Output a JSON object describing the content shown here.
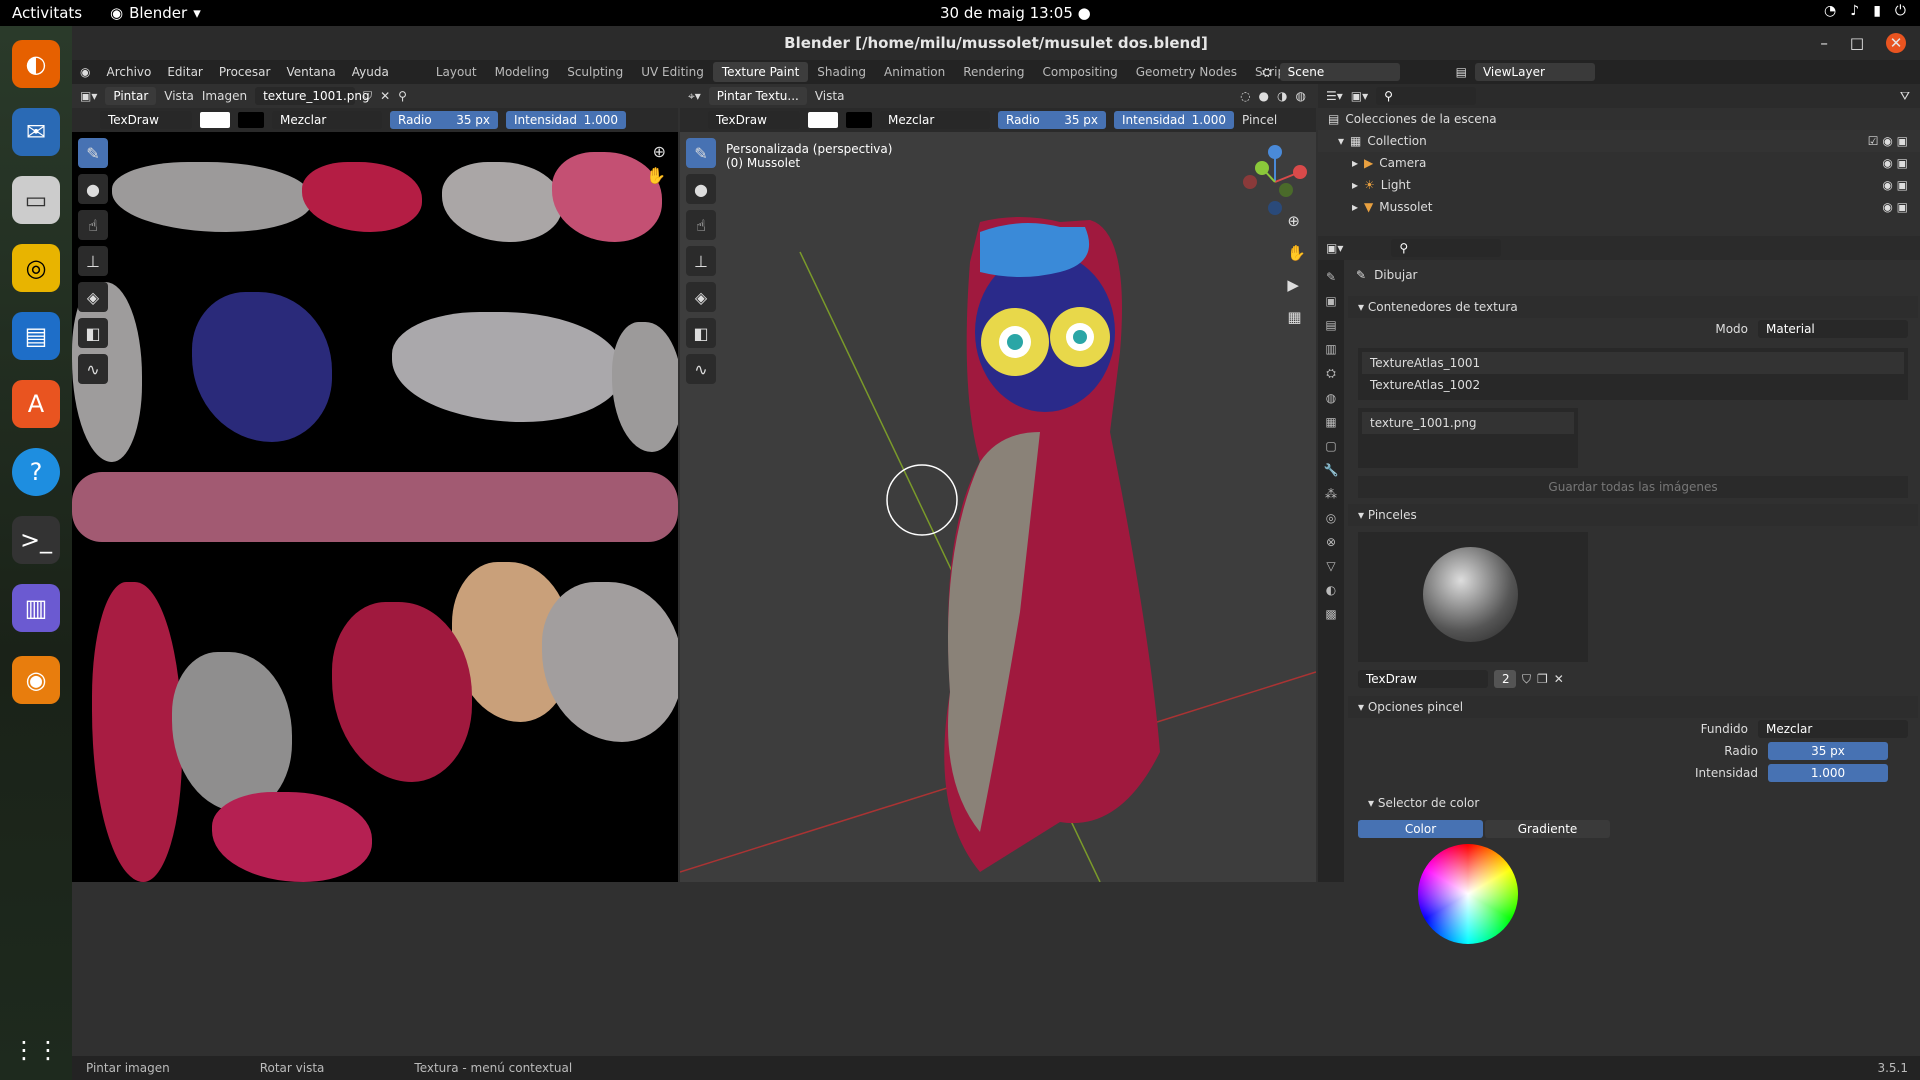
{
  "system": {
    "activities": "Activitats",
    "app_name": "Blender",
    "clock": "30 de maig  13:05"
  },
  "window": {
    "title": "Blender [/home/milu/mussolet/musulet dos.blend]"
  },
  "menu": [
    "Archivo",
    "Editar",
    "Procesar",
    "Ventana",
    "Ayuda"
  ],
  "workspaces": [
    "Layout",
    "Modeling",
    "Sculpting",
    "UV Editing",
    "Texture Paint",
    "Shading",
    "Animation",
    "Rendering",
    "Compositing",
    "Geometry Nodes",
    "Scripting"
  ],
  "active_workspace": "Texture Paint",
  "scene": {
    "scene": "Scene",
    "view_layer": "ViewLayer"
  },
  "image_editor": {
    "mode": "Pintar",
    "menu_vista": "Vista",
    "menu_imagen": "Imagen",
    "image": "texture_1001.png",
    "brush": "TexDraw",
    "blend": "Mezclar",
    "radius_label": "Radio",
    "radius": "35 px",
    "strength_label": "Intensidad",
    "strength": "1.000"
  },
  "viewport": {
    "mode": "Pintar Textu...",
    "menu_vista": "Vista",
    "brush": "TexDraw",
    "blend": "Mezclar",
    "radius_label": "Radio",
    "radius": "35 px",
    "strength_label": "Intensidad",
    "strength": "1.000",
    "brush_tab": "Pincel",
    "info1": "Personalizada (perspectiva)",
    "info2": "(0) Mussolet"
  },
  "outliner": {
    "root": "Colecciones de la escena",
    "collection": "Collection",
    "items": [
      "Camera",
      "Light",
      "Mussolet"
    ]
  },
  "properties": {
    "tool": "Dibujar",
    "section_tex": "Contenedores de textura",
    "mode_label": "Modo",
    "mode": "Material",
    "atlas": [
      "TextureAtlas_1001",
      "TextureAtlas_1002"
    ],
    "texture": "texture_1001.png",
    "save_all": "Guardar todas las imágenes",
    "section_brushes": "Pinceles",
    "brush_name": "TexDraw",
    "brush_users": "2",
    "section_opts": "Opciones pincel",
    "blend_label": "Fundido",
    "blend": "Mezclar",
    "radius_label": "Radio",
    "radius": "35 px",
    "strength_label": "Intensidad",
    "strength": "1.000",
    "color_picker": "Selector de color",
    "tab_color": "Color",
    "tab_gradient": "Gradiente"
  },
  "status": {
    "left": "Pintar imagen",
    "mid": "Rotar vista",
    "right": "Textura - menú contextual",
    "version": "3.5.1"
  }
}
